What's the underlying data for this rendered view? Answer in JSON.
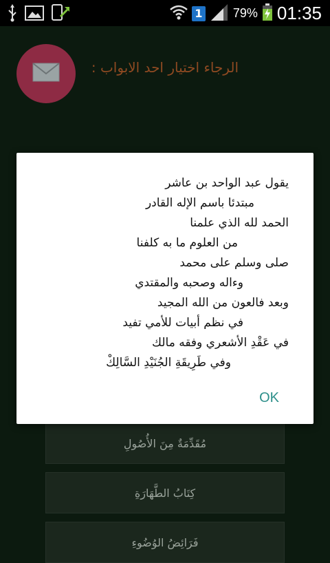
{
  "status_bar": {
    "notification_badge": "1",
    "battery_percent": "79%",
    "time": "01:35"
  },
  "prompt": "الرجاء اختيار احد الابواب :",
  "dialog": {
    "verses": [
      "يقول عبد الواحد بن عاشر",
      "مبتدئا باسم الإله القادر",
      "الحمد لله الذي علمنا",
      "من العلوم ما به كلفنا",
      "صلى وسلم على محمد",
      "وءاله وصحبه والمقتدي",
      "وبعد فالعون من الله المجيد",
      "في نظم أبيات للأمي تفيد",
      "في عَقْدِ الأشعري وفقه مالك",
      "وفي طَرِيقَةِ الجُنَيْدِ السَّالِكْ"
    ],
    "ok_label": "OK"
  },
  "menu": {
    "items": [
      "مُقَدِّمَةٌ مِنَ الأُصُولِ",
      "كِتَابُ الطَّهَارَةِ",
      "فَرَائِضُ الوُضُوءِ"
    ]
  },
  "colors": {
    "accent": "#2d8f8a",
    "fab": "#8e2b44",
    "prompt": "#8f4a22"
  }
}
